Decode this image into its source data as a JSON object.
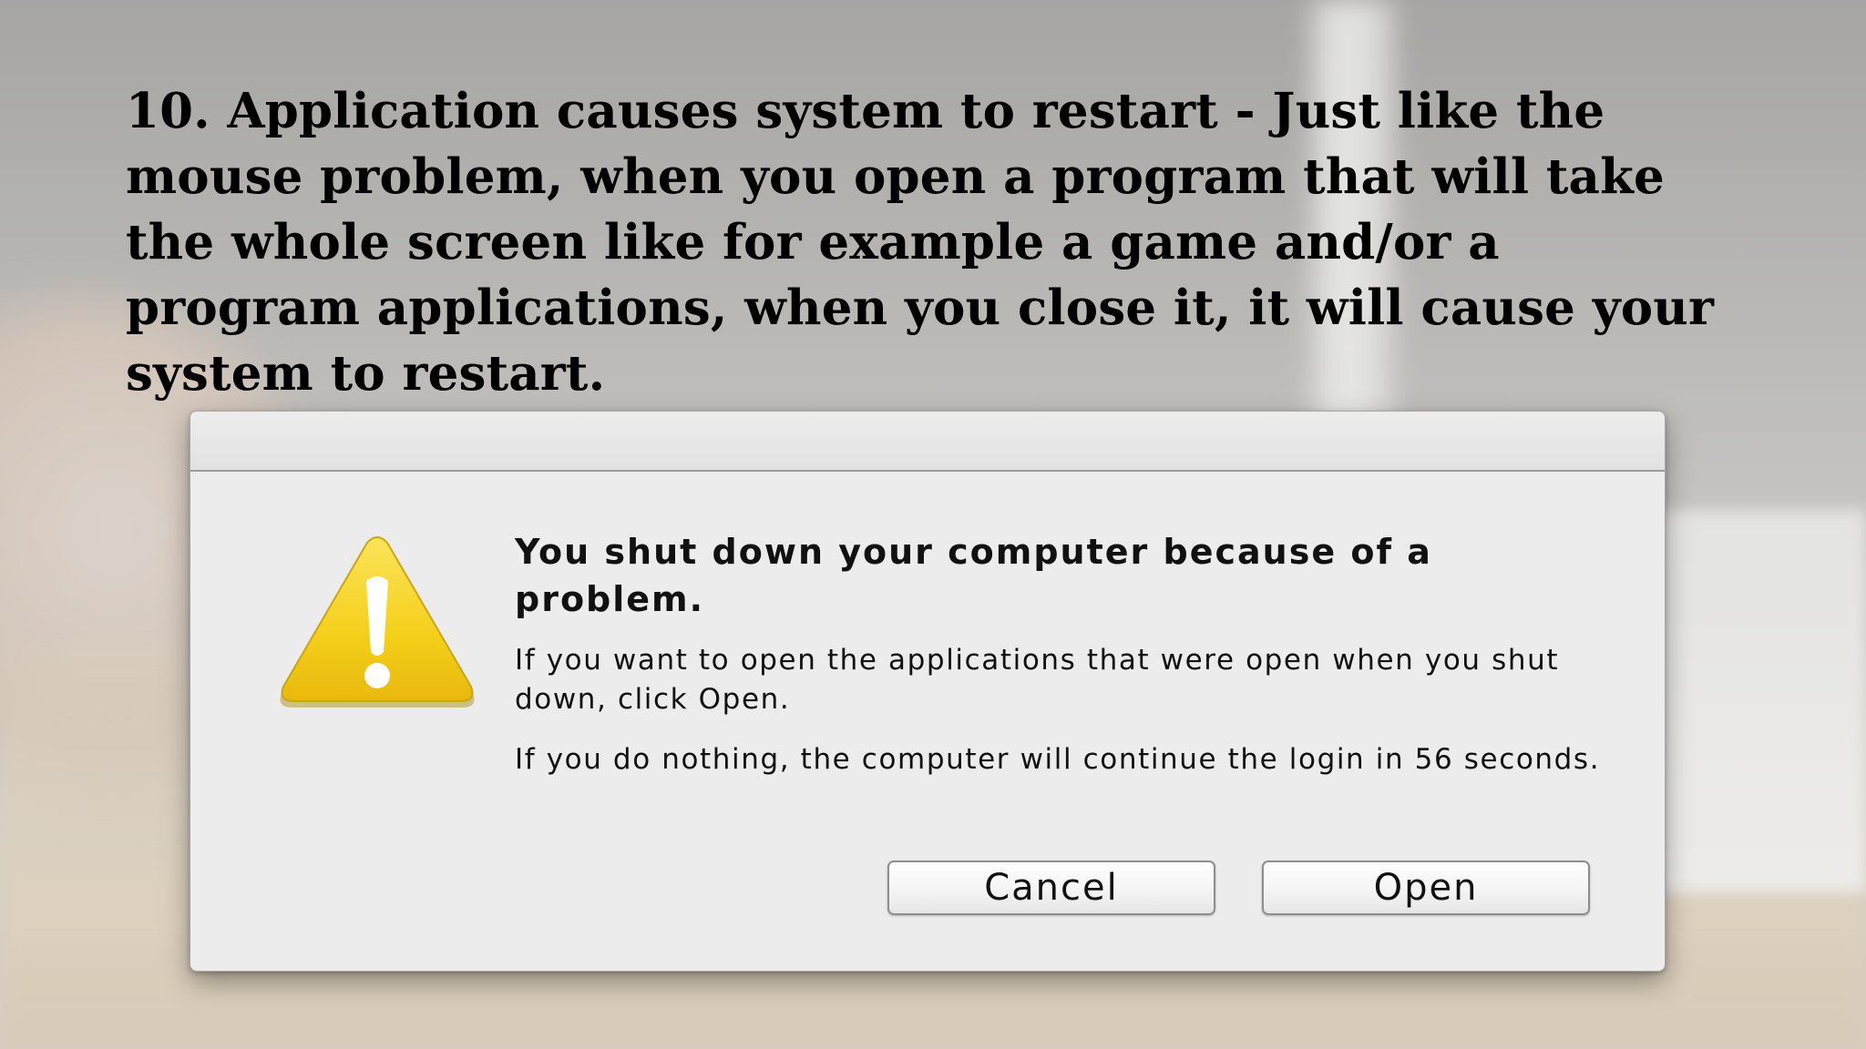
{
  "slide": {
    "paragraph": "10. Application causes system to restart - Just like the mouse problem, when you open a program that will take the whole screen like for example a game and/or a program applications, when you close it, it will cause your system to restart."
  },
  "dialog": {
    "icon": "warning-triangle-icon",
    "heading": "You shut down your computer because of a problem.",
    "message_1": "If you want to open the applications that were open when you shut down, click Open.",
    "message_2": "If you do nothing, the computer will continue the login in 56 seconds.",
    "cancel_label": "Cancel",
    "open_label": "Open"
  },
  "colors": {
    "icon_yellow": "#f7d21f",
    "dialog_bg": "#ececec"
  }
}
